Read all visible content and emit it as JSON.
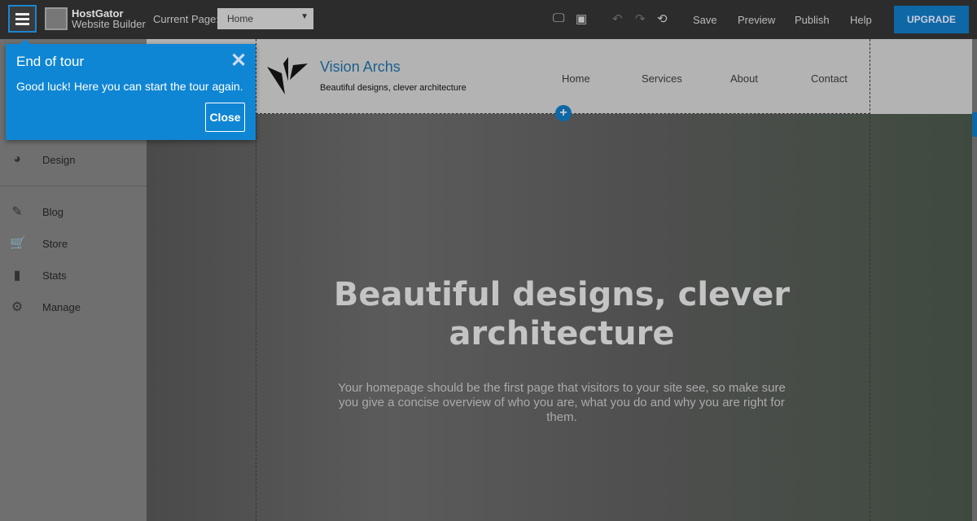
{
  "topbar": {
    "brand_line1": "HostGator",
    "brand_line2": "Website Builder",
    "current_page_label": "Current Page:",
    "current_page_value": "Home",
    "save": "Save",
    "preview": "Preview",
    "publish": "Publish",
    "help": "Help",
    "upgrade": "UPGRADE"
  },
  "sidebar": {
    "items": [
      {
        "label": "Design",
        "icon": "palette-icon"
      },
      {
        "label": "Blog",
        "icon": "pencil-icon"
      },
      {
        "label": "Store",
        "icon": "cart-icon"
      },
      {
        "label": "Stats",
        "icon": "bar-chart-icon"
      },
      {
        "label": "Manage",
        "icon": "gear-icon"
      }
    ]
  },
  "site": {
    "title": "Vision Archs",
    "tagline": "Beautiful designs, clever architecture",
    "nav": [
      "Home",
      "Services",
      "About",
      "Contact"
    ],
    "hero_title": "Beautiful designs, clever architecture",
    "hero_text": "Your homepage should be the first page that visitors to your site see, so make sure you give a concise overview of who you are, what you do and why you are right for them."
  },
  "tour": {
    "title": "End of tour",
    "body": "Good luck! Here you can start the tour again.",
    "close": "Close"
  },
  "colors": {
    "accent": "#0f86d4",
    "upgrade": "#0e68a6",
    "topbar": "#2c2c2c"
  }
}
